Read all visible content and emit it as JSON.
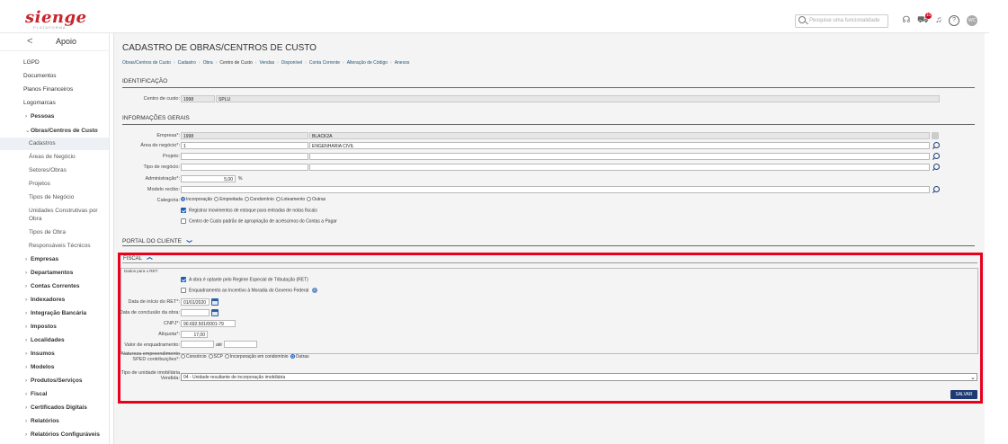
{
  "topbar": {
    "logo": "sienge",
    "logo_sub": "PLATAFORMA",
    "search_placeholder": "Pesquise uma funcionalidade",
    "cart_count": "10",
    "avatar_initials": "WC"
  },
  "sidebar": {
    "back": "<",
    "title": "Apoio",
    "top_items": [
      "LGPD",
      "Documentos",
      "Planos Financeiros",
      "Logomarcas"
    ],
    "groups_before": [
      "Pessoas"
    ],
    "open_group": "Obras/Centros de Custo",
    "open_group_items": [
      "Cadastros",
      "Áreas de Negócio",
      "Setores/Obras",
      "Projetos",
      "Tipos de Negócio",
      "Unidades Construtivas por",
      "Obra",
      "Tipos de Obra",
      "Responsáveis Técnicos"
    ],
    "groups_after": [
      "Empresas",
      "Departamentos",
      "Contas Correntes",
      "Indexadores",
      "Integração Bancária",
      "Impostos",
      "Localidades",
      "Insumos",
      "Modelos",
      "Produtos/Serviços",
      "Fiscal",
      "Certificados Digitais",
      "Relatórios",
      "Relatórios Configuráveis"
    ]
  },
  "page": {
    "title": "CADASTRO DE OBRAS/CENTROS DE CUSTO",
    "breadcrumb": [
      "Obras/Centros de Custo",
      "Cadastro",
      "Obra",
      "Centro de Custo",
      "Vendas",
      "Disponível",
      "Conta Corrente",
      "Alteração de Código",
      "Anexos"
    ]
  },
  "identificacao": {
    "heading": "IDENTIFICAÇÃO",
    "cc_label": "Centro de custo:",
    "cc_code": "1998",
    "cc_name": "SPLU"
  },
  "gerais": {
    "heading": "INFORMAÇÕES GERAIS",
    "empresa_label": "Empresa*:",
    "empresa_code": "1998",
    "empresa_name": "BLACK2A",
    "area_label": "Área de negócio*:",
    "area_code": "1",
    "area_name": "ENGENHARIA CIVIL",
    "projeto_label": "Projeto:",
    "tipo_label": "Tipo de negócio:",
    "adm_label": "Administração*:",
    "adm_value": "5,00",
    "adm_unit": "%",
    "modelo_label": "Modelo recibo:",
    "categoria_label": "Categoria:",
    "categoria_options": [
      "Incorporação",
      "Empreitada",
      "Condomínio",
      "Loteamento",
      "Outras"
    ],
    "check1": "Registrar movimentos de estoque para entradas de notas fiscais",
    "check2": "Centro de Custo padrão de apropriação de acréscimos do Contas a Pagar"
  },
  "portal": {
    "heading": "PORTAL DO CLIENTE",
    "toggle": "❯"
  },
  "fiscal": {
    "tab": "FISCAL",
    "ret_legend": "Dados para o RET:",
    "ret_check": "A obra é optante pelo Regime Especial de Tributação (RET)",
    "moradia_check": "Enquadramento ao Incentivo à Moradia do Governo Federal",
    "inicio_label": "Data de início do RET*:",
    "inicio_value": "01/01/2020",
    "conclusao_label": "Data de conclusão da obra:",
    "cnpj_label": "CNPJ*:",
    "cnpj_value": "90.692.501/0001-79",
    "aliquota_label": "Alíquota*:",
    "aliquota_value": "17,00",
    "enq_label": "Valor de enquadramento:",
    "ate": "até",
    "natureza_label_1": "Natureza empreendimento",
    "natureza_label_2": "SPED contribuições*:",
    "natureza_options": [
      "Consórcio",
      "SCP",
      "Incorporação em condomínio",
      "Outras"
    ],
    "tipo_label_1": "Tipo de unidade imobiliária",
    "tipo_label_2": "Vendida:",
    "tipo_value": "04 - Unidade resultante de incorporação imobiliária",
    "save": "SALVAR"
  }
}
